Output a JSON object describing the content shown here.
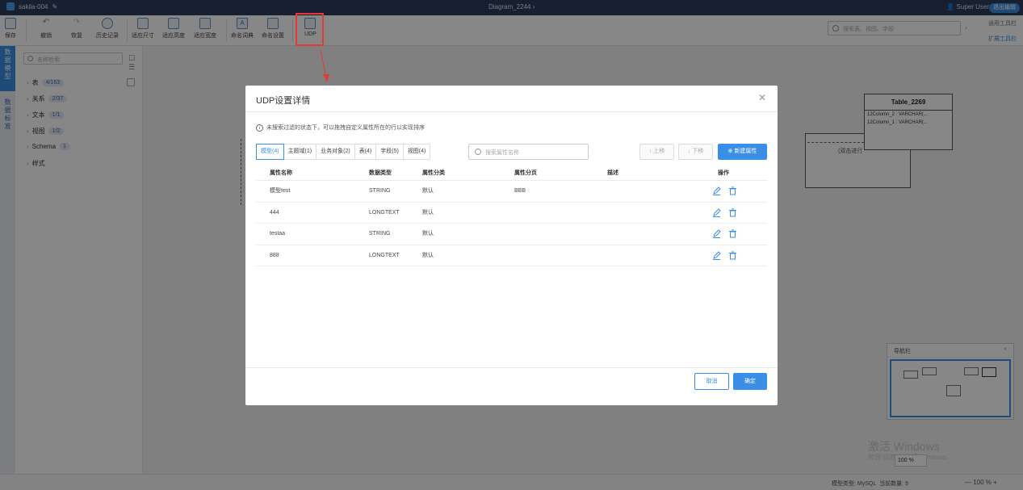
{
  "topbar": {
    "project": "sakila-004",
    "diagram": "Diagram_2244",
    "user": "Super User",
    "exit_edit": "退出编辑"
  },
  "toolbar": {
    "buttons": [
      "保存",
      "撤销",
      "恢复",
      "历史记录",
      "适应尺寸",
      "适应高度",
      "适应宽度",
      "命名词典",
      "命名设置",
      "UDP"
    ],
    "search_placeholder": "搜索表、视图、字段",
    "common_toolbar": "通用工具栏",
    "extend_toolbar": "扩展工具栏"
  },
  "left_rail": {
    "tab1": "数据模型",
    "tab2": "数据标准"
  },
  "left_panel": {
    "search_placeholder": "名称检索",
    "tree": [
      {
        "label": "表",
        "count": "4/163"
      },
      {
        "label": "关系",
        "count": "2/37"
      },
      {
        "label": "文本",
        "count": "1/1"
      },
      {
        "label": "视图",
        "count": "1/2"
      },
      {
        "label": "Schema",
        "count": "1"
      },
      {
        "label": "样式",
        "count": ""
      }
    ]
  },
  "canvas": {
    "table_name": "Table_2269",
    "table_rows": [
      "12Column_2 : VARCHAR(...",
      "12Column_1 : VARCHAR(..."
    ],
    "box_hint": "(双击进行",
    "navigator_title": "导航栏",
    "zoom_value": "100 %",
    "watermark_title": "激活 Windows",
    "watermark_sub": "转到\"设置\"以激活 Windows。"
  },
  "status": {
    "model_type": "模型类型: MySQL",
    "count": "当前数量: 9",
    "zoom": "100 %"
  },
  "modal": {
    "title": "UDP设置详情",
    "info": "未搜索过滤的状态下，可以拖拽自定义属性所在的行以实现排序",
    "tabs": [
      "模型(4)",
      "主题域(1)",
      "业务对象(2)",
      "表(4)",
      "字段(5)",
      "视图(4)"
    ],
    "search_placeholder": "搜索属性名称",
    "move_up": "上移",
    "move_down": "下移",
    "new_attr": "新建属性",
    "columns": [
      "属性名称",
      "数据类型",
      "属性分类",
      "属性分页",
      "描述",
      "操作"
    ],
    "rows": [
      {
        "name": "模型test",
        "type": "STRING",
        "category": "默认",
        "page": "BBB",
        "desc": ""
      },
      {
        "name": "444",
        "type": "LONGTEXT",
        "category": "默认",
        "page": "",
        "desc": ""
      },
      {
        "name": "testaa",
        "type": "STRING",
        "category": "默认",
        "page": "",
        "desc": ""
      },
      {
        "name": "888",
        "type": "LONGTEXT",
        "category": "默认",
        "page": "",
        "desc": ""
      }
    ],
    "cancel": "取消",
    "ok": "确定"
  },
  "colors": {
    "accent": "#3a8ee6",
    "topbar": "#2c3e5c",
    "highlight": "#e53935"
  }
}
